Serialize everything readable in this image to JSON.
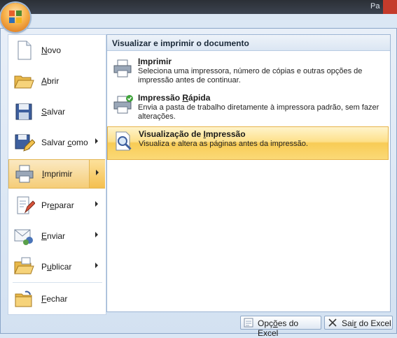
{
  "window": {
    "title_fragment": "Pa",
    "title_fragment2": ""
  },
  "left_menu": [
    {
      "label_pre": "",
      "label_key": "N",
      "label_post": "ovo",
      "icon": "new-document-icon",
      "has_submenu": false
    },
    {
      "label_pre": "",
      "label_key": "A",
      "label_post": "brir",
      "icon": "open-folder-icon",
      "has_submenu": false
    },
    {
      "label_pre": "",
      "label_key": "S",
      "label_post": "alvar",
      "icon": "save-disk-icon",
      "has_submenu": false
    },
    {
      "label_pre": "Salvar ",
      "label_key": "c",
      "label_post": "omo",
      "icon": "save-as-icon",
      "has_submenu": true
    },
    {
      "label_pre": "",
      "label_key": "I",
      "label_post": "mprimir",
      "icon": "printer-icon",
      "has_submenu": true
    },
    {
      "label_pre": "Pr",
      "label_key": "e",
      "label_post": "parar",
      "icon": "prepare-icon",
      "has_submenu": true
    },
    {
      "label_pre": "",
      "label_key": "E",
      "label_post": "nviar",
      "icon": "send-icon",
      "has_submenu": true
    },
    {
      "label_pre": "P",
      "label_key": "u",
      "label_post": "blicar",
      "icon": "publish-icon",
      "has_submenu": true
    },
    {
      "label_pre": "",
      "label_key": "F",
      "label_post": "echar",
      "icon": "close-folder-icon",
      "has_submenu": false
    }
  ],
  "submenu": {
    "header": "Visualizar e imprimir o documento",
    "items": [
      {
        "title_pre": "",
        "title_key": "I",
        "title_post": "mprimir",
        "description": "Seleciona uma impressora, número de cópias e outras opções de impressão antes de continuar.",
        "icon": "printer-icon"
      },
      {
        "title_pre": "Impressão ",
        "title_key": "R",
        "title_post": "ápida",
        "description": "Envia a pasta de trabalho diretamente à impressora padrão, sem fazer alterações.",
        "icon": "quick-print-icon"
      },
      {
        "title_pre": "Visualização de ",
        "title_key": "I",
        "title_post": "mpressão",
        "description": "Visualiza e altera as páginas antes da impressão.",
        "icon": "print-preview-icon"
      }
    ]
  },
  "buttons": {
    "options_pre": "Opç",
    "options_key": "õ",
    "options_post": "es do Excel",
    "exit_pre": "Sai",
    "exit_key": "r",
    "exit_post": " do Excel"
  },
  "colors": {
    "highlight": "#f8cc55",
    "border": "#8aa6c8"
  }
}
